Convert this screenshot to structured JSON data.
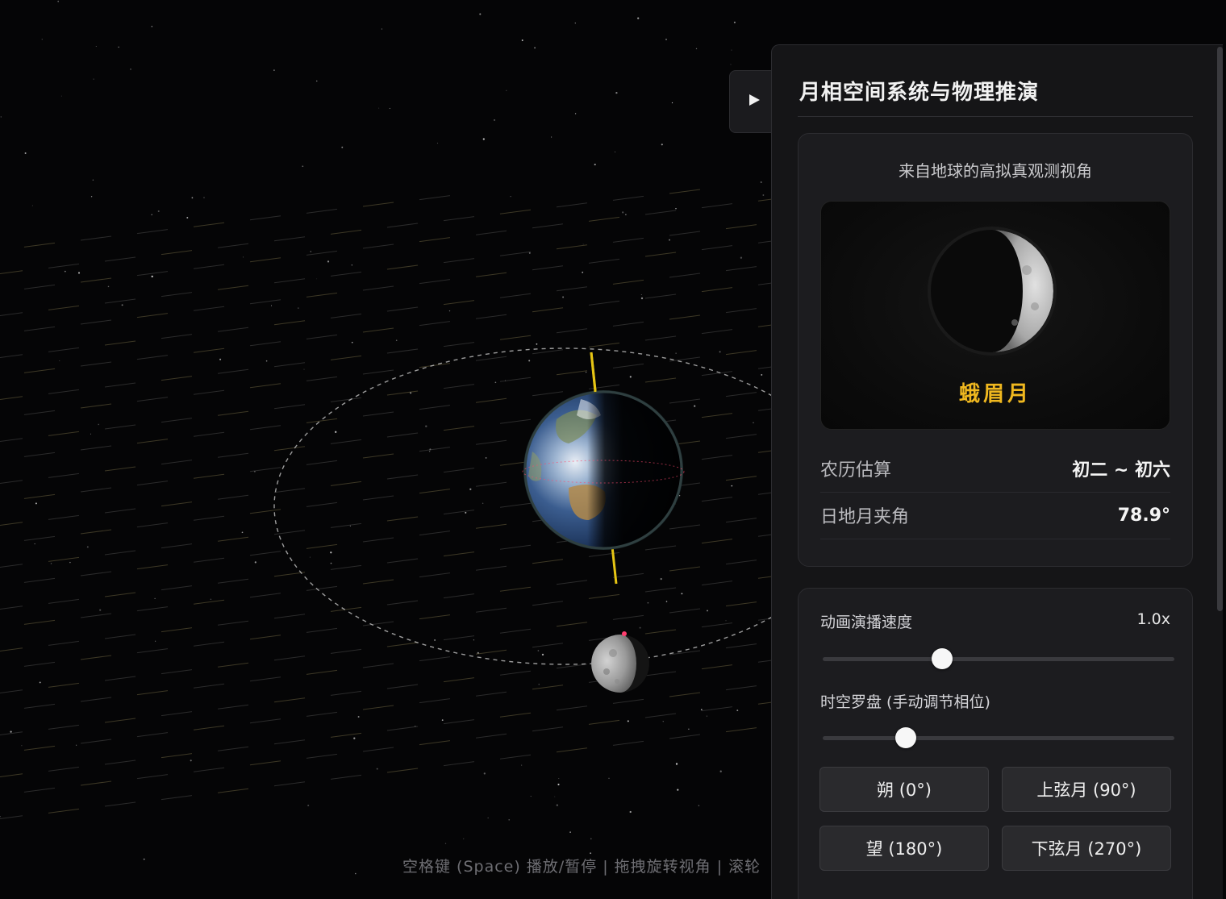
{
  "colors": {
    "accent_phase": "#f0b81f",
    "axis": "#e6c514",
    "panel_bg": "#151517"
  },
  "scene": {
    "hint": "空格键 (Space) 播放/暂停 | 拖拽旋转视角 | 滚轮",
    "play_icon": "play-icon"
  },
  "panel": {
    "title": "月相空间系统与物理推演",
    "observation": {
      "caption": "来自地球的高拟真观测视角",
      "phase_name": "蛾眉月",
      "rows": [
        {
          "label": "农历估算",
          "value": "初二 ~ 初六"
        },
        {
          "label": "日地月夹角",
          "value": "78.9°"
        }
      ]
    },
    "controls": {
      "speed_label": "动画演播速度",
      "speed_value": "1.0x",
      "speed_fraction": 0.34,
      "compass_label": "时空罗盘 (手动调节相位)",
      "compass_fraction": 0.236,
      "buttons": [
        "朔 (0°)",
        "上弦月 (90°)",
        "望 (180°)",
        "下弦月 (270°)"
      ]
    }
  }
}
